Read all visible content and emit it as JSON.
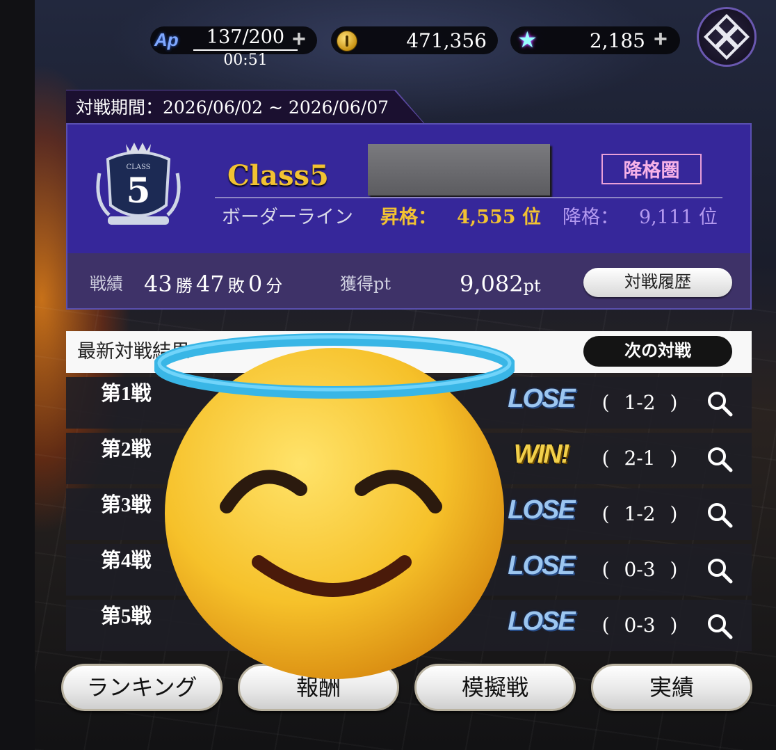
{
  "resources": {
    "ap_label": "Ap",
    "ap_current": "137/200",
    "ap_timer": "00:51",
    "coins": "471,356",
    "gems": "2,185",
    "plus": "+"
  },
  "period": "対戦期間：2026/06/02 ~ 2026/06/07",
  "class_panel": {
    "emblem_text": "CLASS",
    "emblem_number": "5",
    "class_name": "Class5",
    "zone_badge": "降格圏",
    "border_label": "ボーダーライン",
    "promotion_label": "昇格：",
    "promotion_value": "4,555 位",
    "demotion_label": "降格：",
    "demotion_value": "9,111 位",
    "record_label": "戦績",
    "wins": "43",
    "wins_unit": "勝",
    "losses": "47",
    "losses_unit": "敗",
    "draws": "0",
    "draws_unit": "分",
    "points_label": "獲得pt",
    "points_value": "9,082",
    "points_unit": "pt",
    "history_button": "対戦履歴"
  },
  "results": {
    "title": "最新対戦結果",
    "next_button": "次の対戦",
    "matches": [
      {
        "label": "第1戦",
        "result": "LOSE",
        "score": "( 1-2 )"
      },
      {
        "label": "第2戦",
        "result": "WIN!",
        "score": "( 2-1 )"
      },
      {
        "label": "第3戦",
        "result": "LOSE",
        "score": "( 1-2 )"
      },
      {
        "label": "第4戦",
        "result": "LOSE",
        "score": "( 0-3 )"
      },
      {
        "label": "第5戦",
        "result": "LOSE",
        "score": "( 0-3 )"
      }
    ]
  },
  "bottom_nav": {
    "ranking": "ランキング",
    "rewards": "報酬",
    "practice": "模擬戦",
    "achievements": "実績"
  },
  "colors": {
    "panel": "#36279a",
    "gold": "#f2c232",
    "lose": "#9cc6f0",
    "win": "#f2d04a"
  },
  "icons": [
    "coin-icon",
    "star-gem-icon",
    "menu-crest-icon",
    "class-emblem-icon",
    "zoom-icon",
    "smiling-face-with-halo-emoji"
  ]
}
